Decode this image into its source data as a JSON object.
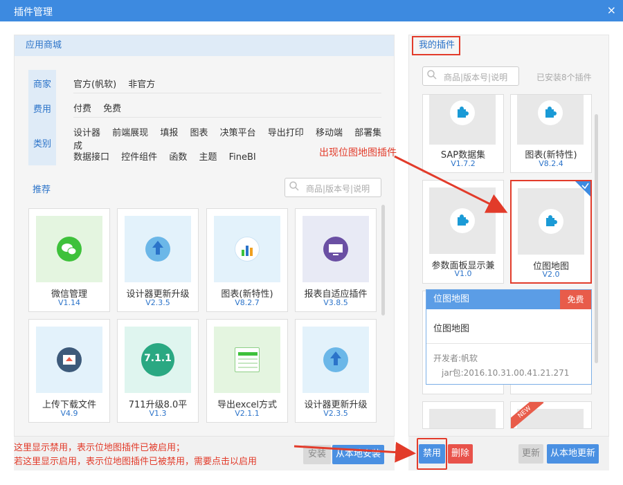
{
  "window": {
    "title": "插件管理",
    "close_icon": "×"
  },
  "store": {
    "header": "应用商城",
    "filter_labels": [
      "商家",
      "费用",
      "类别"
    ],
    "vendor_options": [
      "官方(帆软)",
      "非官方"
    ],
    "fee_options": [
      "付费",
      "免费"
    ],
    "category_row1": [
      "设计器",
      "前端展现",
      "填报",
      "图表",
      "决策平台",
      "导出打印",
      "移动端",
      "部署集成"
    ],
    "category_row2": [
      "数据接口",
      "控件组件",
      "函数",
      "主题",
      "FineBI"
    ],
    "recommend_label": "推荐",
    "search_placeholder": "商品|版本号|说明",
    "plugins": [
      {
        "name": "微信管理",
        "version": "V1.14"
      },
      {
        "name": "设计器更新升级",
        "version": "V2.3.5"
      },
      {
        "name": "图表(新特性)",
        "version": "V8.2.7"
      },
      {
        "name": "报表自适应插件",
        "version": "V3.8.5"
      },
      {
        "name": "上传下载文件",
        "version": "V4.9"
      },
      {
        "name": "711升级8.0平",
        "version": "V1.3"
      },
      {
        "name": "导出excel方式",
        "version": "V2.1.1"
      },
      {
        "name": "设计器更新升级",
        "version": "V2.3.5"
      }
    ],
    "thumb_711": "7.1.1",
    "install_button": "安装",
    "local_install_button": "从本地安装"
  },
  "mine": {
    "header": "我的插件",
    "search_placeholder": "商品|版本号|说明",
    "installed_count": "已安装8个插件",
    "plugins": [
      {
        "name": "SAP数据集",
        "version": "V1.7.2"
      },
      {
        "name": "图表(新特性)",
        "version": "V8.2.4"
      },
      {
        "name": "参数面板显示兼",
        "version": "V1.0"
      },
      {
        "name": "位图地图",
        "version": "V2.0"
      }
    ],
    "detail": {
      "title": "位图地图",
      "fee_badge": "免费",
      "name": "位图地图",
      "developer": "开发者:帆软",
      "jar": "jar包:2016.10.31.00.41.21.271"
    },
    "new_badge": "NEW",
    "disable_button": "禁用",
    "delete_button": "删除",
    "update_button": "更新",
    "local_update_button": "从本地更新"
  },
  "annotations": {
    "bitmap_plugin": "出现位图地图插件",
    "note_line1": "这里显示禁用，表示位地图插件已被启用；",
    "note_line2": "若这里显示启用，表示位地图插件已被禁用，需要点击以启用"
  },
  "colors": {
    "titlebar": "#3d8ae0",
    "accent": "#2b73c9",
    "annotation_red": "#e23b2a",
    "primary_button": "#4a90e2",
    "delete_button": "#e8524a"
  }
}
